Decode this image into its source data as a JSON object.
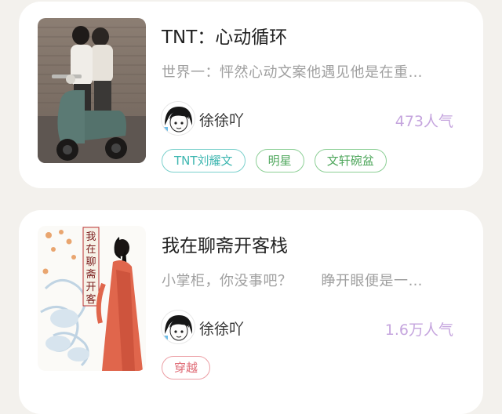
{
  "books": [
    {
      "title": "TNT：心动循环",
      "excerpt": "世界一：怦然心动文案他遇见他是在重…",
      "author": "徐徐吖",
      "popularity": "473人气",
      "tags": [
        "TNT刘耀文",
        "明星",
        "文轩碗盆"
      ],
      "cover_icon": "scooter-photo-icon"
    },
    {
      "title": "我在聊斋开客栈",
      "excerpt": "小掌柜，你没事吧？　　睁开眼便是一…",
      "author": "徐徐吖",
      "popularity": "1.6万人气",
      "tags": [
        "穿越"
      ],
      "cover_title": "我在聊斋开客栈",
      "cover_icon": "fox-spirit-illustration-icon"
    }
  ],
  "colors": {
    "background": "#f3f1ed",
    "card": "#ffffff",
    "popularity": "#c5a5de",
    "tag_teal": "#3fb7b1",
    "tag_green": "#4fa75c",
    "tag_pink": "#de6671"
  }
}
